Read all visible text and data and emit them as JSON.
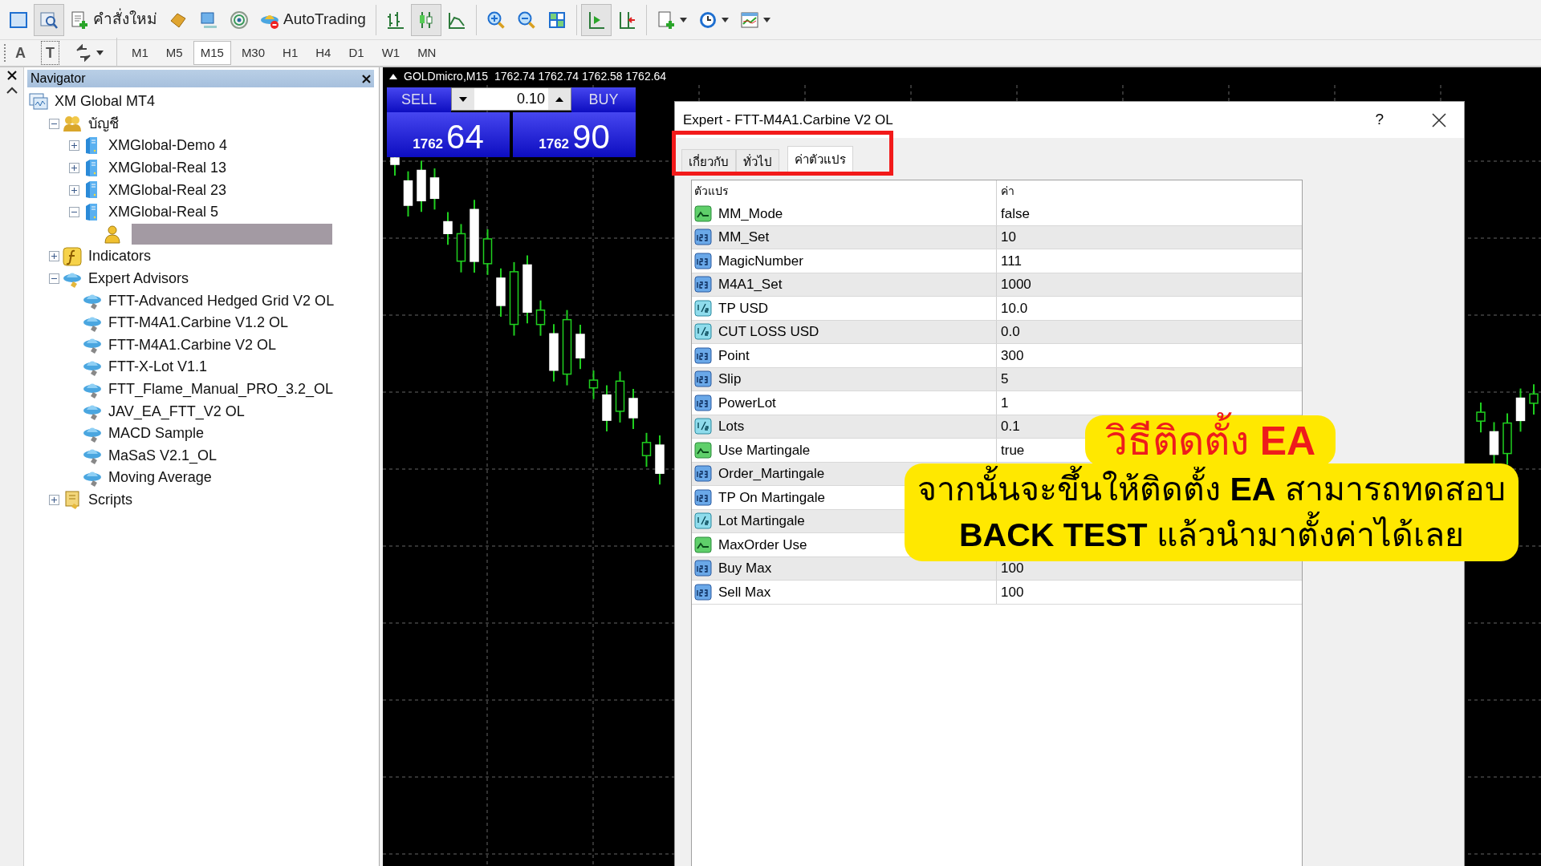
{
  "toolbar": {
    "buttons": [
      {
        "pressed": false
      },
      {
        "pressed": true
      },
      {
        "label": "คำสั่งใหม่",
        "pressed": false
      },
      {
        "pressed": false
      },
      {
        "pressed": false
      },
      {
        "pressed": false
      },
      {
        "label": "AutoTrading",
        "pressed": false
      },
      {
        "pressed": false
      },
      {
        "pressed": true
      },
      {
        "pressed": false
      },
      {
        "pressed": false
      },
      {
        "pressed": false
      },
      {
        "pressed": false
      },
      {
        "pressed": true
      },
      {
        "pressed": false
      },
      {
        "pressed": false
      },
      {
        "pressed": false
      },
      {
        "pressed": false
      }
    ]
  },
  "drawing_tools": [
    "A",
    "T"
  ],
  "timeframes": [
    {
      "label": "M1",
      "selected": false
    },
    {
      "label": "M5",
      "selected": false
    },
    {
      "label": "M15",
      "selected": true
    },
    {
      "label": "M30",
      "selected": false
    },
    {
      "label": "H1",
      "selected": false
    },
    {
      "label": "H4",
      "selected": false
    },
    {
      "label": "D1",
      "selected": false
    },
    {
      "label": "W1",
      "selected": false
    },
    {
      "label": "MN",
      "selected": false
    }
  ],
  "navigator": {
    "title": "Navigator",
    "tree": [
      {
        "label": "XM Global MT4",
        "kind": "terminal",
        "children": [
          {
            "label": "บัญชี",
            "kind": "accounts",
            "expanded": true,
            "children": [
              {
                "label": "XMGlobal-Demo 4",
                "kind": "server",
                "expanded": false
              },
              {
                "label": "XMGlobal-Real 13",
                "kind": "server",
                "expanded": false
              },
              {
                "label": "XMGlobal-Real 23",
                "kind": "server",
                "expanded": false
              },
              {
                "label": "XMGlobal-Real 5",
                "kind": "server",
                "expanded": true,
                "children": [
                  {
                    "kind": "user",
                    "redacted": true
                  }
                ]
              }
            ]
          },
          {
            "label": "Indicators",
            "kind": "indicators",
            "expanded": false
          },
          {
            "label": "Expert Advisors",
            "kind": "experts",
            "expanded": true,
            "children": [
              {
                "label": "FTT-Advanced Hedged Grid V2 OL",
                "kind": "expert"
              },
              {
                "label": "FTT-M4A1.Carbine V1.2 OL",
                "kind": "expert"
              },
              {
                "label": "FTT-M4A1.Carbine V2 OL",
                "kind": "expert"
              },
              {
                "label": "FTT-X-Lot V1.1",
                "kind": "expert"
              },
              {
                "label": "FTT_Flame_Manual_PRO_3.2_OL",
                "kind": "expert"
              },
              {
                "label": "JAV_EA_FTT_V2 OL",
                "kind": "expert"
              },
              {
                "label": "MACD Sample",
                "kind": "expert"
              },
              {
                "label": "MaSaS V2.1_OL",
                "kind": "expert"
              },
              {
                "label": "Moving Average",
                "kind": "expert"
              }
            ]
          },
          {
            "label": "Scripts",
            "kind": "scripts",
            "expanded": false
          }
        ]
      }
    ]
  },
  "chart": {
    "symbol": "GOLDmicro,M15",
    "quotes": "1762.74 1762.74 1762.58 1762.64",
    "trade_panel": {
      "sell_label": "SELL",
      "buy_label": "BUY",
      "lot": "0.10",
      "sell_price": {
        "base": "1762",
        "pips": "64"
      },
      "buy_price": {
        "base": "1762",
        "pips": "90"
      }
    }
  },
  "dialog": {
    "title": "Expert - FTT-M4A1.Carbine V2 OL",
    "help": "?",
    "tabs": [
      {
        "label": "เกี่ยวกับ",
        "selected": false
      },
      {
        "label": "ทั่วไป",
        "selected": false
      },
      {
        "label": "ค่าตัวแปร",
        "selected": true
      }
    ],
    "table": {
      "columns": [
        "ตัวแปร",
        "ค่า"
      ],
      "rows": [
        {
          "name": "MM_Mode",
          "kind": "bool",
          "value": "false"
        },
        {
          "name": "MM_Set",
          "kind": "int",
          "value": "10"
        },
        {
          "name": "MagicNumber",
          "kind": "int",
          "value": "111"
        },
        {
          "name": "M4A1_Set",
          "kind": "int",
          "value": "1000"
        },
        {
          "name": "TP USD",
          "kind": "double",
          "value": "10.0"
        },
        {
          "name": "CUT LOSS USD",
          "kind": "double",
          "value": "0.0"
        },
        {
          "name": "Point",
          "kind": "int",
          "value": "300"
        },
        {
          "name": "Slip",
          "kind": "int",
          "value": "5"
        },
        {
          "name": "PowerLot",
          "kind": "int",
          "value": "1"
        },
        {
          "name": "Lots",
          "kind": "double",
          "value": "0.1"
        },
        {
          "name": "Use Martingale",
          "kind": "bool",
          "value": "true"
        },
        {
          "name": "Order_Martingale",
          "kind": "int"
        },
        {
          "name": "TP On Martingale",
          "kind": "int"
        },
        {
          "name": "Lot Martingale",
          "kind": "double"
        },
        {
          "name": "MaxOrder Use",
          "kind": "bool"
        },
        {
          "name": "Buy Max",
          "kind": "int",
          "value": "100"
        },
        {
          "name": "Sell Max",
          "kind": "int",
          "value": "100"
        }
      ]
    }
  },
  "caption": {
    "title": "วิธีติดตั้ง **EA**",
    "lines": [
      "จากนั้นจะขึ้นให้ติดตั้ง **EA** สามารถทดสอบ",
      "**BACK TEST** แล้วนำมาตั้งค่าได้เลย"
    ]
  }
}
